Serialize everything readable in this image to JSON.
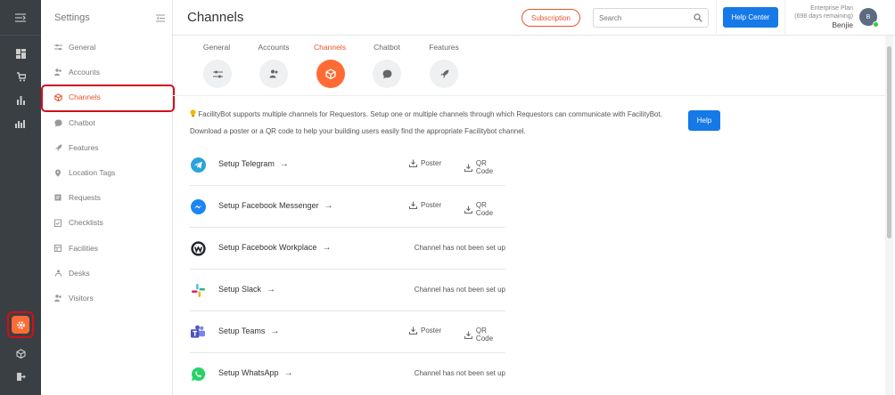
{
  "colors": {
    "accent": "#ff6b35",
    "accent_text": "#e8542c",
    "primary": "#1679e8",
    "rail": "#3a3f44",
    "highlight": "#d0101a"
  },
  "rail": {
    "top_icon": "collapse-icon",
    "items": [
      "dashboard-icon",
      "cart-icon",
      "chart-icon",
      "analytics-icon"
    ],
    "bottom": [
      "gear-icon",
      "cube-icon",
      "logout-icon"
    ]
  },
  "sidebar": {
    "title": "Settings",
    "items": [
      {
        "label": "General",
        "icon": "sliders-icon"
      },
      {
        "label": "Accounts",
        "icon": "users-icon"
      },
      {
        "label": "Channels",
        "icon": "cube-icon",
        "active": true
      },
      {
        "label": "Chatbot",
        "icon": "chat-icon"
      },
      {
        "label": "Features",
        "icon": "rocket-icon"
      },
      {
        "label": "Location Tags",
        "icon": "pin-icon"
      },
      {
        "label": "Requests",
        "icon": "request-icon"
      },
      {
        "label": "Checklists",
        "icon": "checklist-icon"
      },
      {
        "label": "Facilities",
        "icon": "facility-icon"
      },
      {
        "label": "Desks",
        "icon": "desk-icon"
      },
      {
        "label": "Visitors",
        "icon": "visitor-icon"
      }
    ]
  },
  "header": {
    "title": "Channels",
    "subscription": "Subscription",
    "search_placeholder": "Search",
    "help_center": "Help Center",
    "plan": "Enterprise Plan",
    "plan_remaining": "(698 days remaining)",
    "user": "Benjie",
    "avatar_initial": "B"
  },
  "tabs": [
    {
      "label": "General",
      "icon": "sliders-icon"
    },
    {
      "label": "Accounts",
      "icon": "users-icon"
    },
    {
      "label": "Channels",
      "icon": "cube-icon",
      "active": true
    },
    {
      "label": "Chatbot",
      "icon": "chat-icon"
    },
    {
      "label": "Features",
      "icon": "rocket-icon"
    }
  ],
  "content": {
    "info": "FacilityBot supports multiple channels for Requestors. Setup one or multiple channels through which Requestors can communicate with FacilityBot.",
    "info2": "Download a poster or a QR code to help your building users easily find the appropriate Facilitybot channel.",
    "help": "Help",
    "arrow": "→",
    "poster": "Poster",
    "qr": "QR Code",
    "channels": [
      {
        "label": "Setup Telegram",
        "icon": "telegram-icon",
        "setup": true
      },
      {
        "label": "Setup Facebook Messenger",
        "icon": "messenger-icon",
        "setup": true
      },
      {
        "label": "Setup Facebook Workplace",
        "icon": "workplace-icon",
        "setup": false,
        "status": "Channel has not been set up"
      },
      {
        "label": "Setup Slack",
        "icon": "slack-icon",
        "setup": false,
        "status": "Channel has not been set up"
      },
      {
        "label": "Setup Teams",
        "icon": "teams-icon",
        "setup": true
      },
      {
        "label": "Setup WhatsApp",
        "icon": "whatsapp-icon",
        "setup": false,
        "status": "Channel has not been set up"
      }
    ]
  }
}
